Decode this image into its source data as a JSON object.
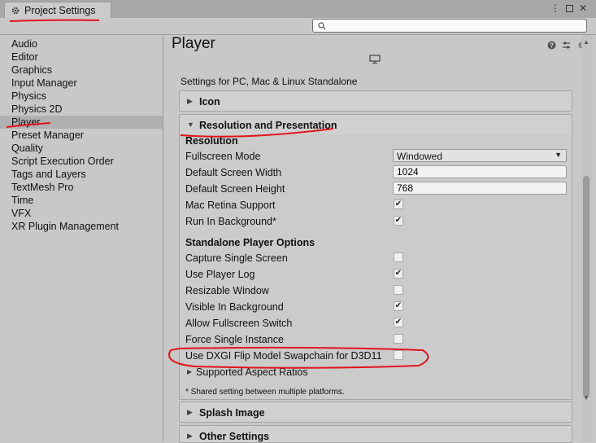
{
  "window": {
    "tab_title": "Project Settings",
    "search": {
      "value": "",
      "placeholder": ""
    }
  },
  "sidebar": {
    "items": [
      {
        "label": "Audio"
      },
      {
        "label": "Editor"
      },
      {
        "label": "Graphics"
      },
      {
        "label": "Input Manager"
      },
      {
        "label": "Physics"
      },
      {
        "label": "Physics 2D"
      },
      {
        "label": "Player",
        "selected": true
      },
      {
        "label": "Preset Manager"
      },
      {
        "label": "Quality"
      },
      {
        "label": "Script Execution Order"
      },
      {
        "label": "Tags and Layers"
      },
      {
        "label": "TextMesh Pro"
      },
      {
        "label": "Time"
      },
      {
        "label": "VFX"
      },
      {
        "label": "XR Plugin Management"
      }
    ]
  },
  "main": {
    "title": "Player",
    "platform_label": "Settings for PC, Mac & Linux Standalone",
    "sections": {
      "icon": "Icon",
      "resolution": "Resolution and Presentation",
      "splash": "Splash Image",
      "other": "Other Settings"
    },
    "resolution": {
      "group_label": "Resolution",
      "fullscreen_mode": {
        "label": "Fullscreen Mode",
        "value": "Windowed"
      },
      "width": {
        "label": "Default Screen Width",
        "value": "1024"
      },
      "height": {
        "label": "Default Screen Height",
        "value": "768"
      },
      "mac_retina": {
        "label": "Mac Retina Support",
        "checked": true
      },
      "run_in_bg": {
        "label": "Run In Background*",
        "checked": true
      }
    },
    "standalone": {
      "group_label": "Standalone Player Options",
      "options": [
        {
          "label": "Capture Single Screen",
          "checked": false
        },
        {
          "label": "Use Player Log",
          "checked": true
        },
        {
          "label": "Resizable Window",
          "checked": false
        },
        {
          "label": "Visible In Background",
          "checked": true
        },
        {
          "label": "Allow Fullscreen Switch",
          "checked": true
        },
        {
          "label": "Force Single Instance",
          "checked": false
        },
        {
          "label": "Use DXGI Flip Model Swapchain for D3D11",
          "checked": false
        }
      ],
      "aspect_ratios": "Supported Aspect Ratios",
      "note": "* Shared setting between multiple platforms."
    }
  },
  "icons": {
    "gear": "gear-icon",
    "help": "help-icon",
    "presets": "presets-icon",
    "search": "search-icon",
    "monitor": "monitor-icon"
  },
  "colors": {
    "annotation": "#e0141b",
    "checkmark": "#222222"
  }
}
